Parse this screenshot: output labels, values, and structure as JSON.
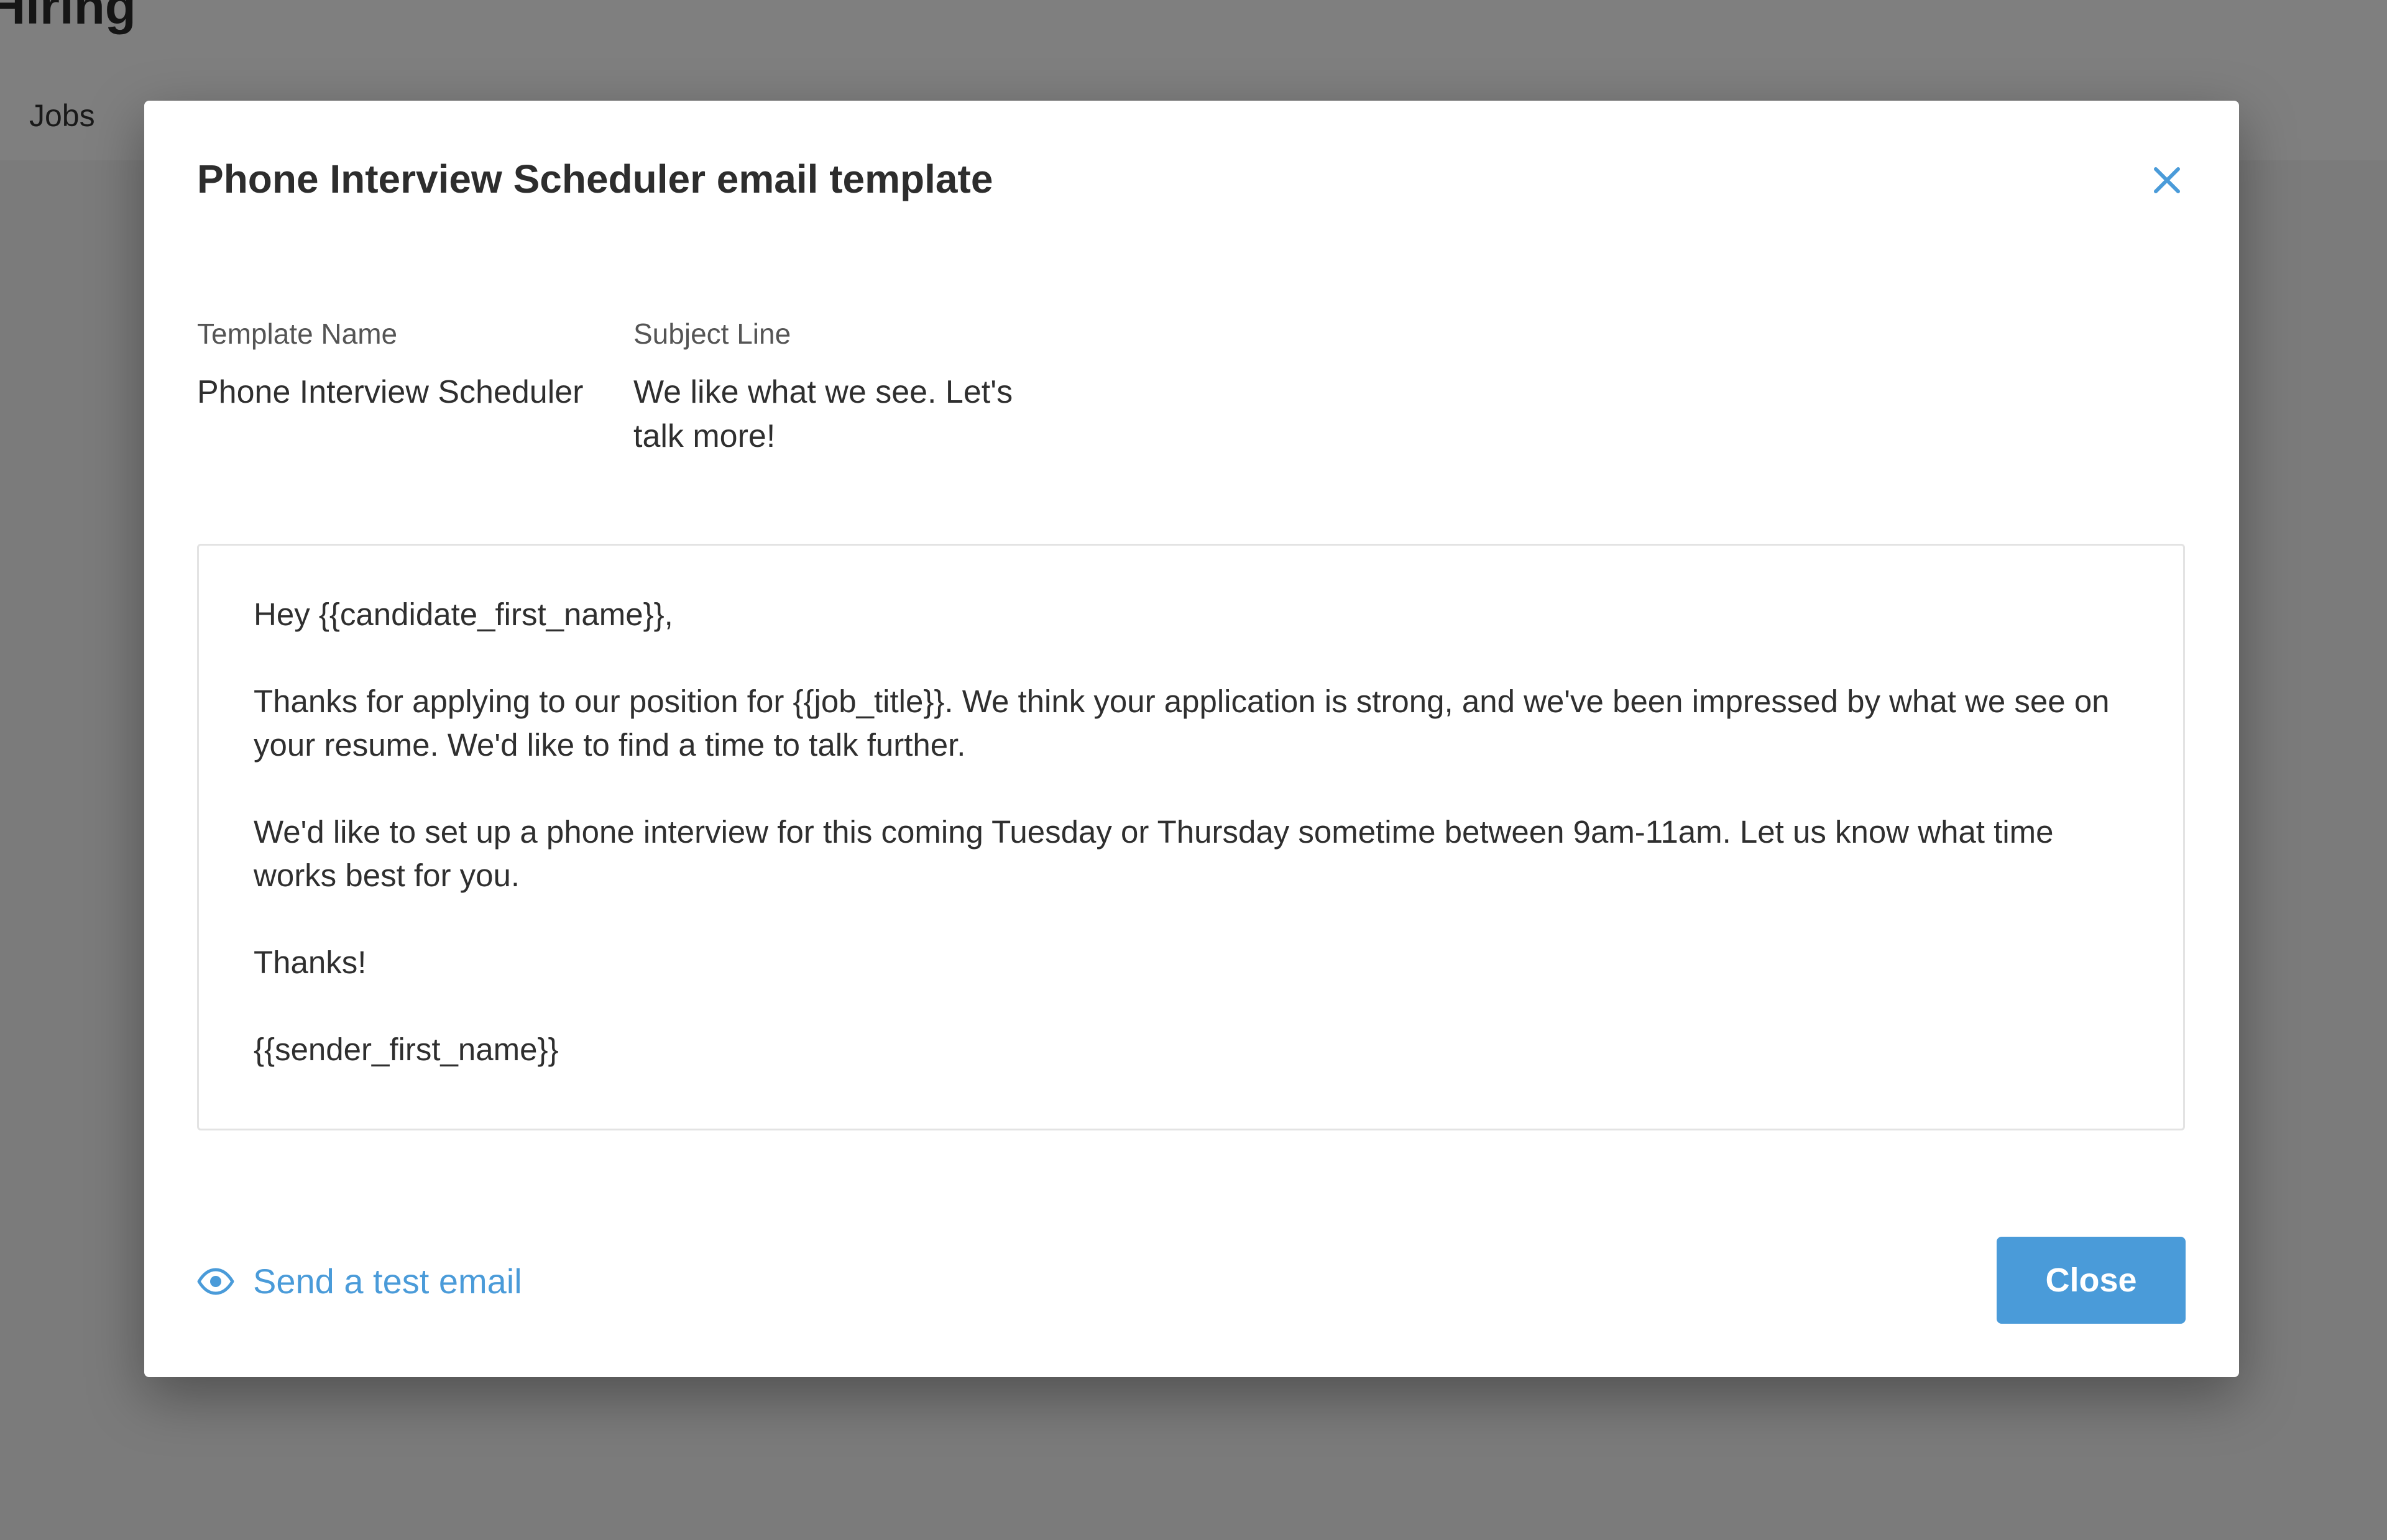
{
  "background": {
    "title": "Hiring",
    "nav": {
      "jobs_label": "Jobs"
    }
  },
  "modal": {
    "title": "Phone Interview Scheduler email template",
    "close_icon": "close-x-icon",
    "template_name": {
      "label": "Template Name",
      "value": "Phone Interview Scheduler"
    },
    "subject_line": {
      "label": "Subject Line",
      "value": "We like what we see. Let's talk more!"
    },
    "body": {
      "paragraphs": [
        "Hey {{candidate_first_name}},",
        "Thanks for applying to our position for {{job_title}}. We think your application is strong, and we've been impressed by what we see on your resume. We'd like to find a time to talk further.",
        "We'd like to set up a phone interview for this coming Tuesday or Thursday sometime between 9am-11am. Let us know what time works best for you.",
        "Thanks!",
        "{{sender_first_name}}"
      ]
    },
    "footer": {
      "send_test_label": "Send a test email",
      "send_test_icon": "eye-icon",
      "close_button_label": "Close"
    }
  },
  "colors": {
    "accent": "#4a9bd9",
    "text": "#2f2f2f",
    "muted": "#555555",
    "overlay": "rgba(0,0,0,0.5)"
  }
}
